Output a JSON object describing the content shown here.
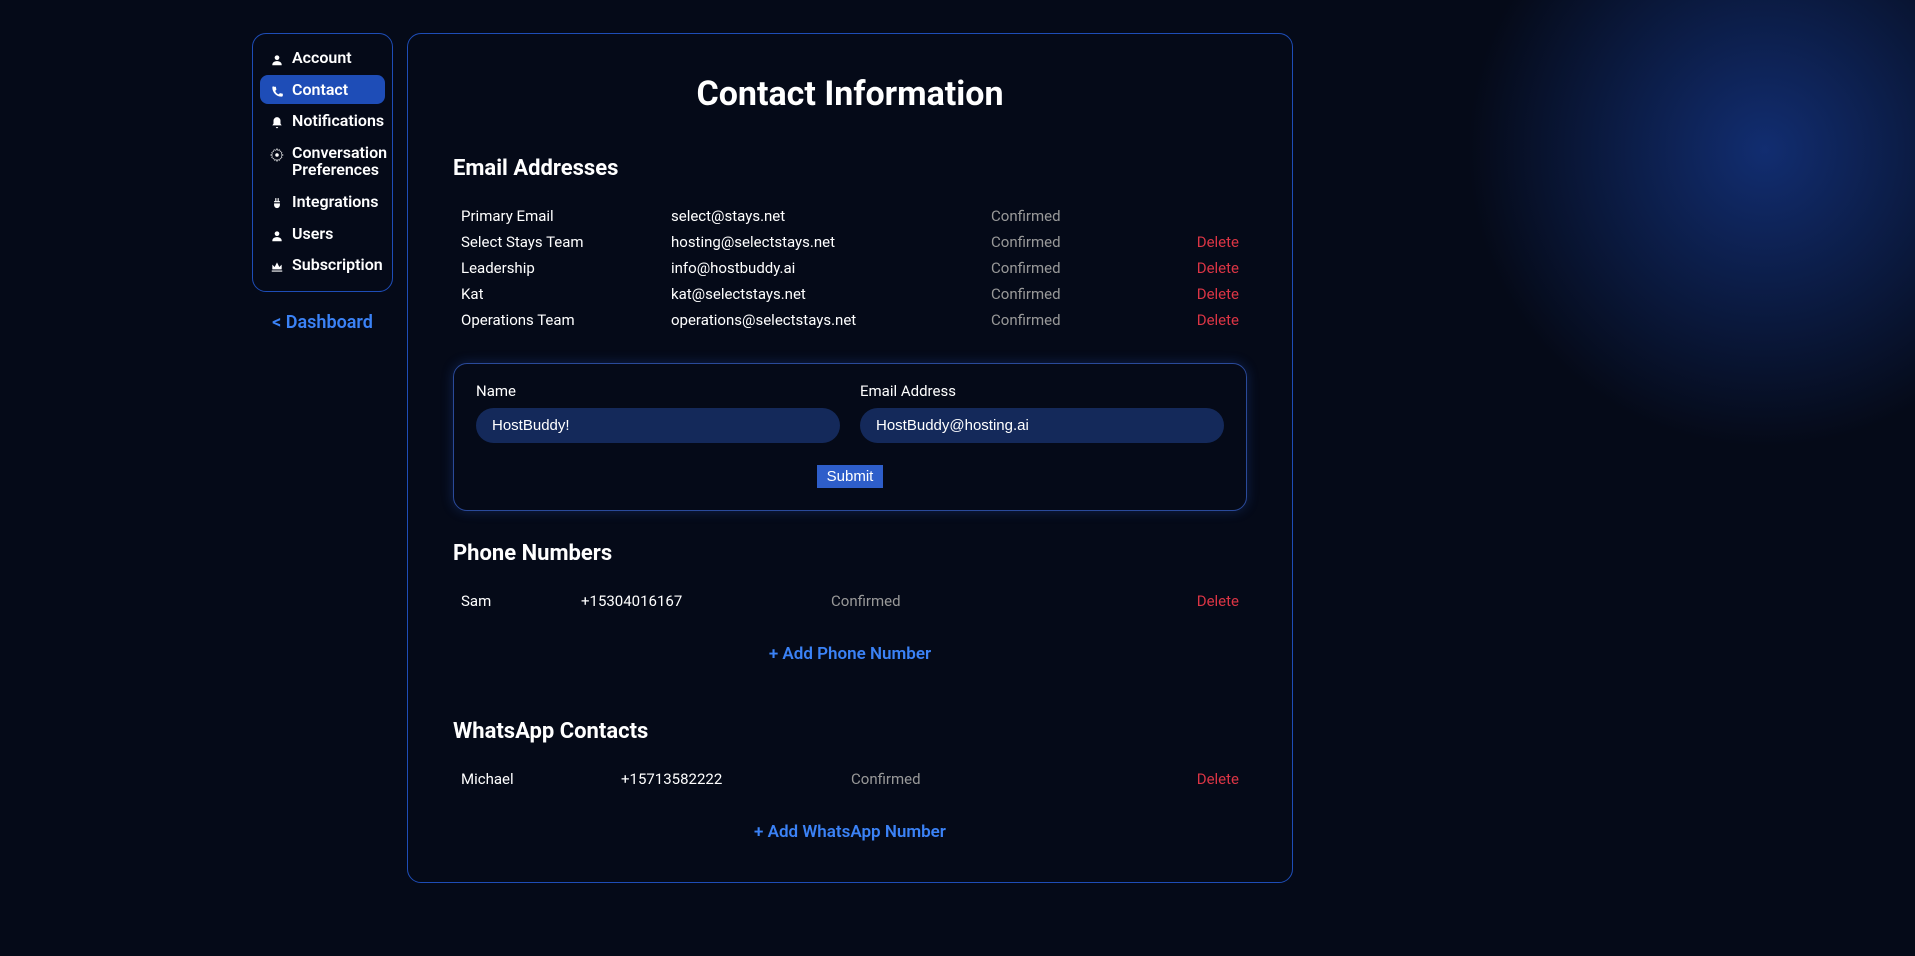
{
  "sidebar": {
    "items": [
      {
        "label": "Account"
      },
      {
        "label": "Contact"
      },
      {
        "label": "Notifications"
      },
      {
        "label": "Conversation Preferences"
      },
      {
        "label": "Integrations"
      },
      {
        "label": "Users"
      },
      {
        "label": "Subscription"
      }
    ],
    "dashboard_link": "< Dashboard"
  },
  "page": {
    "title": "Contact Information"
  },
  "emails": {
    "section_title": "Email Addresses",
    "rows": [
      {
        "name": "Primary Email",
        "address": "select@stays.net",
        "status": "Confirmed",
        "deletable": false
      },
      {
        "name": "Select Stays Team",
        "address": "hosting@selectstays.net",
        "status": "Confirmed",
        "deletable": true
      },
      {
        "name": "Leadership",
        "address": "info@hostbuddy.ai",
        "status": "Confirmed",
        "deletable": true
      },
      {
        "name": "Kat",
        "address": "kat@selectstays.net",
        "status": "Confirmed",
        "deletable": true
      },
      {
        "name": "Operations Team",
        "address": "operations@selectstays.net",
        "status": "Confirmed",
        "deletable": true
      }
    ],
    "delete_label": "Delete",
    "form": {
      "name_label": "Name",
      "name_value": "HostBuddy!",
      "email_label": "Email Address",
      "email_value": "HostBuddy@hosting.ai",
      "submit_label": "Submit"
    }
  },
  "phones": {
    "section_title": "Phone Numbers",
    "rows": [
      {
        "name": "Sam",
        "number": "+15304016167",
        "status": "Confirmed"
      }
    ],
    "delete_label": "Delete",
    "add_label": "+ Add Phone Number"
  },
  "whatsapp": {
    "section_title": "WhatsApp Contacts",
    "rows": [
      {
        "name": "Michael",
        "number": "+15713582222",
        "status": "Confirmed"
      }
    ],
    "delete_label": "Delete",
    "add_label": "+ Add WhatsApp Number"
  }
}
